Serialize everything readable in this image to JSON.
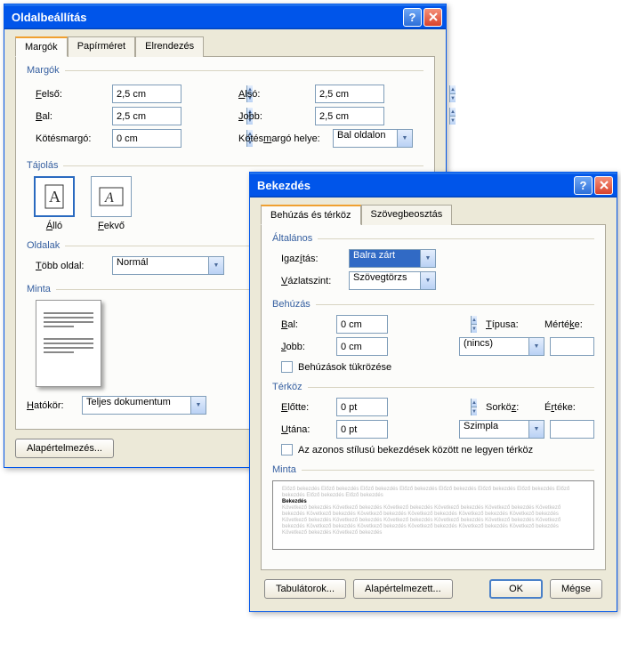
{
  "dialog1": {
    "title": "Oldalbeállítás",
    "tabs": {
      "margins": "Margók",
      "paper": "Papírméret",
      "layout": "Elrendezés"
    },
    "groups": {
      "margins": "Margók",
      "orientation": "Tájolás",
      "pages": "Oldalak",
      "preview": "Minta"
    },
    "labels": {
      "top": "Felső:",
      "bottom": "Alsó:",
      "left": "Bal:",
      "right": "Jobb:",
      "gutter": "Kötésmargó:",
      "gutter_pos": "Kötésmargó helye:",
      "portrait": "Álló",
      "landscape": "Fekvő",
      "multipage": "Több oldal:",
      "applyto": "Hatókör:"
    },
    "values": {
      "top": "2,5 cm",
      "bottom": "2,5 cm",
      "left": "2,5 cm",
      "right": "2,5 cm",
      "gutter": "0 cm",
      "gutter_pos": "Bal oldalon",
      "multipage": "Normál",
      "applyto": "Teljes dokumentum"
    },
    "buttons": {
      "defaults": "Alapértelmezés..."
    }
  },
  "dialog2": {
    "title": "Bekezdés",
    "tabs": {
      "indent": "Behúzás és térköz",
      "flow": "Szövegbeosztás"
    },
    "groups": {
      "general": "Általános",
      "indent": "Behúzás",
      "spacing": "Térköz",
      "preview": "Minta"
    },
    "labels": {
      "alignment": "Igazítás:",
      "outline": "Vázlatszint:",
      "left": "Bal:",
      "right": "Jobb:",
      "special": "Típusa:",
      "by1": "Mértéke:",
      "mirror": "Behúzások tükrözése",
      "before": "Előtte:",
      "after": "Utána:",
      "linespacing": "Sorköz:",
      "at": "Értéke:",
      "nospace": "Az azonos stílusú bekezdések között ne legyen térköz"
    },
    "values": {
      "alignment": "Balra zárt",
      "outline": "Szövegtörzs",
      "left": "0 cm",
      "right": "0 cm",
      "special": "(nincs)",
      "by1": "",
      "before": "0 pt",
      "after": "0 pt",
      "linespacing": "Szimpla",
      "at": ""
    },
    "preview": {
      "filler": "Előző bekezdés Előző bekezdés Előző bekezdés Előző bekezdés Előző bekezdés Előző bekezdés Előző bekezdés Előző bekezdés Előző bekezdés Előző bekezdés",
      "sample": "Bekezdés",
      "after": "Következő bekezdés Következő bekezdés Következő bekezdés Következő bekezdés Következő bekezdés Következő bekezdés Következő bekezdés Következő bekezdés Következő bekezdés Következő bekezdés Következő bekezdés Következő bekezdés Következő bekezdés Következő bekezdés Következő bekezdés Következő bekezdés Következő bekezdés Következő bekezdés Következő bekezdés Következő bekezdés Következő bekezdés Következő bekezdés Következő bekezdés Következő bekezdés"
    },
    "buttons": {
      "tabs": "Tabulátorok...",
      "defaults": "Alapértelmezett...",
      "ok": "OK",
      "cancel": "Mégse"
    }
  }
}
